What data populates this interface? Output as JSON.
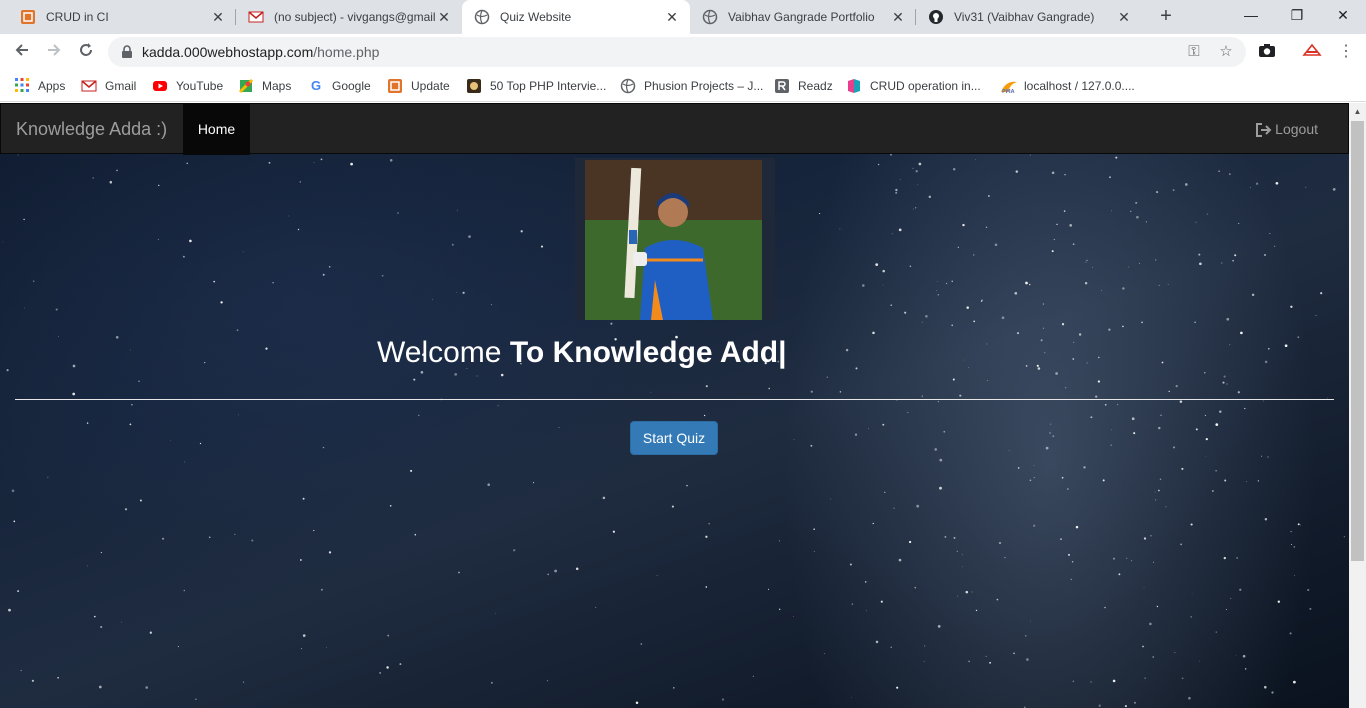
{
  "browser": {
    "tabs": [
      {
        "title": "CRUD in CI",
        "icon": "codeigniter-icon",
        "active": false
      },
      {
        "title": "(no subject) - vivgangs@gmail",
        "icon": "gmail-icon",
        "active": false
      },
      {
        "title": "Quiz Website",
        "icon": "globe-icon",
        "active": true
      },
      {
        "title": "Vaibhav Gangrade Portfolio",
        "icon": "globe-icon",
        "active": false
      },
      {
        "title": "Viv31 (Vaibhav Gangrade)",
        "icon": "github-icon",
        "active": false
      }
    ],
    "new_tab_label": "+",
    "window_controls": {
      "minimize": "—",
      "maximize": "❐",
      "close": "✕"
    },
    "url_host": "kadda.000webhostapp.com",
    "url_path": "/home.php",
    "bookmarks": [
      {
        "label": "Apps",
        "icon": "apps-grid-icon"
      },
      {
        "label": "Gmail",
        "icon": "gmail-icon"
      },
      {
        "label": "YouTube",
        "icon": "youtube-icon"
      },
      {
        "label": "Maps",
        "icon": "maps-icon"
      },
      {
        "label": "Google",
        "icon": "google-icon"
      },
      {
        "label": "Update",
        "icon": "codeigniter-icon"
      },
      {
        "label": "50 Top PHP Intervie...",
        "icon": "bookmark-site-icon"
      },
      {
        "label": "Phusion Projects – J...",
        "icon": "globe-icon"
      },
      {
        "label": "Readz",
        "icon": "readz-icon"
      },
      {
        "label": "CRUD operation in...",
        "icon": "crud-icon"
      },
      {
        "label": "localhost / 127.0.0....",
        "icon": "phpmyadmin-icon"
      }
    ],
    "colors": {
      "tabstrip": "#dee1e6",
      "omnibox": "#f1f3f4"
    }
  },
  "page": {
    "brand": "Knowledge Adda :)",
    "nav_home": "Home",
    "logout_label": "Logout",
    "welcome_regular": "Welcome ",
    "welcome_bold": "To Knowledge Add|",
    "start_button": "Start Quiz",
    "colors": {
      "navbar": "#222222",
      "button": "#337ab7"
    }
  }
}
